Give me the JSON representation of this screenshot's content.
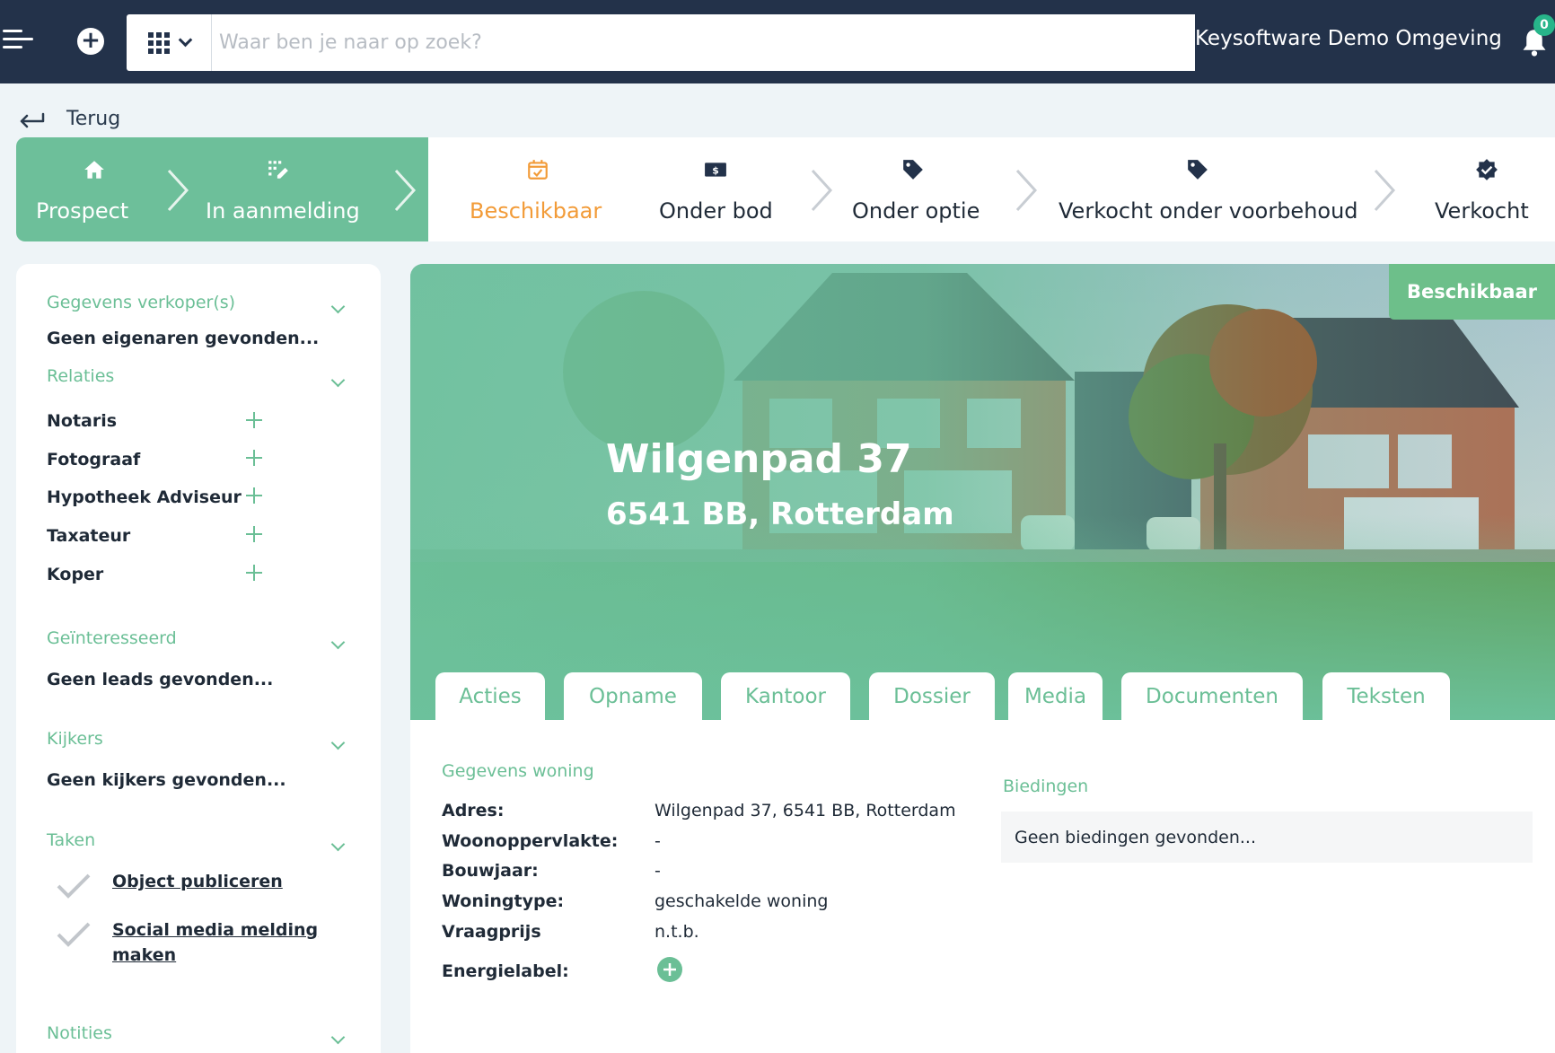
{
  "topbar": {
    "search_placeholder": "Waar ben je naar op zoek?",
    "environment_name": "Keysoftware Demo Omgeving",
    "notification_count": "0",
    "icons": [
      "menu-icon",
      "plus-icon",
      "apps-grid-icon",
      "chevron-down-icon",
      "bell-icon"
    ]
  },
  "back_label": "Terug",
  "pipeline": {
    "stages": [
      {
        "label": "Prospect",
        "icon": "home-icon",
        "state": "done"
      },
      {
        "label": "In aanmelding",
        "icon": "edit-list-icon",
        "state": "done"
      },
      {
        "label": "Beschikbaar",
        "icon": "calendar-check-icon",
        "state": "active"
      },
      {
        "label": "Onder bod",
        "icon": "money-icon",
        "state": "upcoming"
      },
      {
        "label": "Onder optie",
        "icon": "tag-icon",
        "state": "upcoming"
      },
      {
        "label": "Verkocht onder voorbehoud",
        "icon": "tag-icon",
        "state": "upcoming"
      },
      {
        "label": "Verkocht",
        "icon": "badge-check-icon",
        "state": "upcoming"
      }
    ]
  },
  "sidebar": {
    "sellers": {
      "title": "Gegevens verkoper(s)",
      "empty": "Geen eigenaren gevonden..."
    },
    "relations": {
      "title": "Relaties",
      "items": [
        {
          "label": "Notaris"
        },
        {
          "label": "Fotograaf"
        },
        {
          "label": "Hypotheek Adviseur"
        },
        {
          "label": "Taxateur"
        },
        {
          "label": "Koper"
        }
      ]
    },
    "interested": {
      "title": "Geïnteresseerd",
      "empty": "Geen leads gevonden..."
    },
    "viewers": {
      "title": "Kijkers",
      "empty": "Geen kijkers gevonden..."
    },
    "tasks": {
      "title": "Taken",
      "items": [
        {
          "label": "Object publiceren"
        },
        {
          "label": "Social media melding maken"
        }
      ]
    },
    "notes": {
      "title": "Notities"
    }
  },
  "property": {
    "street": "Wilgenpad 37",
    "postal_city": "6541 BB, Rotterdam",
    "status": "Beschikbaar"
  },
  "tabs": [
    {
      "label": "Acties"
    },
    {
      "label": "Opname"
    },
    {
      "label": "Kantoor"
    },
    {
      "label": "Dossier"
    },
    {
      "label": "Media"
    },
    {
      "label": "Documenten"
    },
    {
      "label": "Teksten"
    }
  ],
  "details": {
    "title": "Gegevens woning",
    "fields": [
      {
        "label": "Adres:",
        "value": "Wilgenpad 37, 6541 BB, Rotterdam"
      },
      {
        "label": "Woonoppervlakte:",
        "value": "-"
      },
      {
        "label": "Bouwjaar:",
        "value": "-"
      },
      {
        "label": "Woningtype:",
        "value": "geschakelde woning"
      },
      {
        "label": "Vraagprijs",
        "value": "n.t.b."
      },
      {
        "label": "Energielabel:",
        "value": ""
      }
    ]
  },
  "bids": {
    "title": "Biedingen",
    "empty": "Geen biedingen gevonden..."
  },
  "colors": {
    "topbar": "#23324a",
    "accent_green": "#6bbf96",
    "pipeline_done": "#6dbf9a",
    "active_stage": "#f29b38",
    "badge": "#27b58a"
  }
}
